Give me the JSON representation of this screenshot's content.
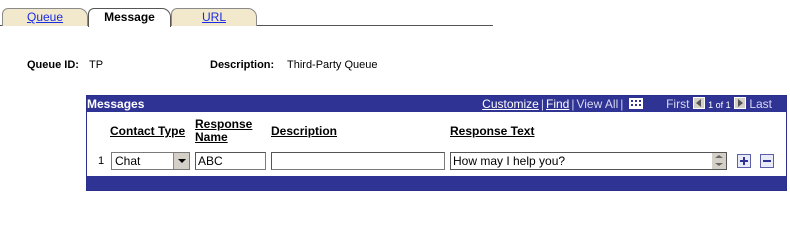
{
  "tabs": [
    {
      "label": "Queue",
      "active": false
    },
    {
      "label": "Message",
      "active": true
    },
    {
      "label": "URL",
      "active": false
    }
  ],
  "header": {
    "queue_id_label": "Queue ID:",
    "queue_id_value": "TP",
    "description_label": "Description:",
    "description_value": "Third-Party Queue"
  },
  "grid": {
    "title": "Messages",
    "nav": {
      "customize": "Customize",
      "find": "Find",
      "view_all": "View All",
      "first": "First",
      "range": "1 of 1",
      "last": "Last"
    },
    "columns": {
      "contact_type": "Contact Type",
      "response_name_line1": "Response",
      "response_name_line2": "Name",
      "description": "Description",
      "response_text": "Response Text"
    },
    "rows": [
      {
        "num": "1",
        "contact_type": "Chat",
        "response_name": "ABC",
        "description": "",
        "response_text": "How may I help you?"
      }
    ]
  },
  "colors": {
    "grid_header": "#2f3394",
    "tab_inactive": "#f2e9cd",
    "link": "#1a2be5"
  },
  "icons": {
    "grid": "grid-icon",
    "prev": "arrow-left-icon",
    "next": "arrow-right-icon",
    "add": "plus-icon",
    "remove": "minus-icon"
  }
}
